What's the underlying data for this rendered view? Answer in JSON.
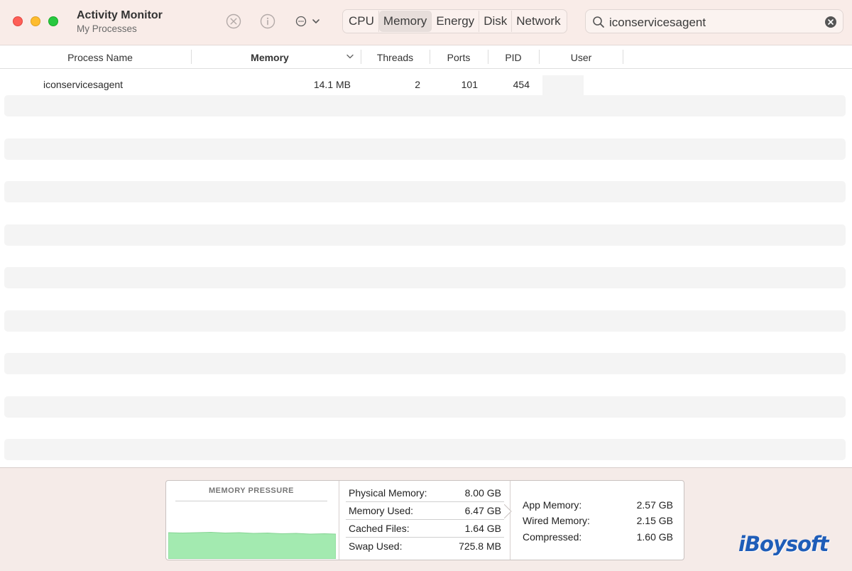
{
  "window": {
    "title": "Activity Monitor",
    "subtitle": "My Processes"
  },
  "toolbar": {
    "stop_icon": "stop-process-icon",
    "info_icon": "info-icon",
    "more_icon": "ellipsis-menu-icon",
    "tabs": [
      {
        "label": "CPU",
        "active": false
      },
      {
        "label": "Memory",
        "active": true
      },
      {
        "label": "Energy",
        "active": false
      },
      {
        "label": "Disk",
        "active": false
      },
      {
        "label": "Network",
        "active": false
      }
    ]
  },
  "search": {
    "value": "iconservicesagent"
  },
  "table": {
    "columns": [
      "Process Name",
      "Memory",
      "Threads",
      "Ports",
      "PID",
      "User"
    ],
    "sorted_column": "Memory",
    "rows": [
      {
        "name": "iconservicesagent",
        "memory": "14.1 MB",
        "threads": "2",
        "ports": "101",
        "pid": "454",
        "user": ""
      }
    ]
  },
  "memory_panel": {
    "pressure_title": "MEMORY PRESSURE",
    "pressure_color": "#a3eab0",
    "stats": [
      {
        "label": "Physical Memory:",
        "value": "8.00 GB"
      },
      {
        "label": "Memory Used:",
        "value": "6.47 GB"
      },
      {
        "label": "Cached Files:",
        "value": "1.64 GB"
      },
      {
        "label": "Swap Used:",
        "value": "725.8 MB"
      }
    ],
    "breakdown": [
      {
        "label": "App Memory:",
        "value": "2.57 GB"
      },
      {
        "label": "Wired Memory:",
        "value": "2.15 GB"
      },
      {
        "label": "Compressed:",
        "value": "1.60 GB"
      }
    ]
  },
  "watermark": "iBoysoft"
}
